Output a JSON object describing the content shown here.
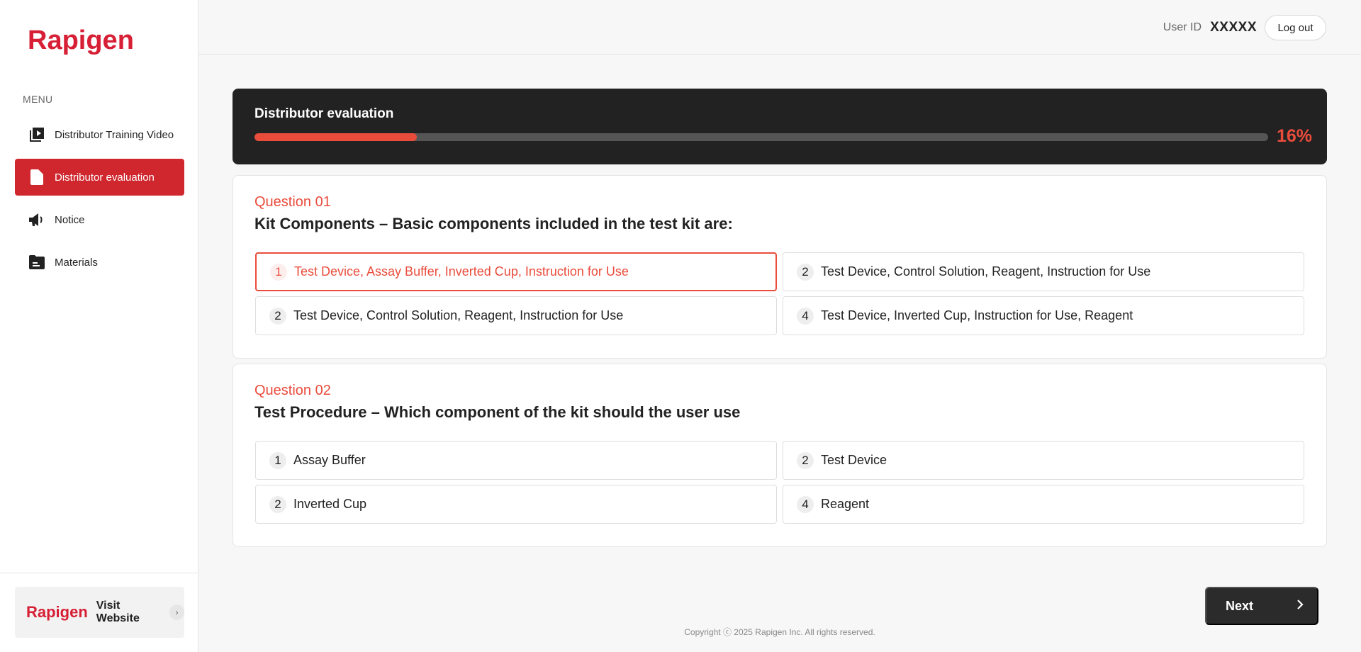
{
  "sidebar": {
    "logo": "Rapigen",
    "menu_label": "MENU",
    "items": [
      {
        "label": "Distributor Training Video",
        "icon": "video-playlist-icon"
      },
      {
        "label": "Distributor evaluation",
        "icon": "document-icon",
        "active": true
      },
      {
        "label": "Notice",
        "icon": "megaphone-icon"
      },
      {
        "label": "Materials",
        "icon": "folder-icon"
      }
    ],
    "visit": {
      "logo": "Rapigen",
      "label": "Visit Website"
    }
  },
  "header": {
    "user_label": "User ID",
    "user_id": "XXXXX",
    "logout_label": "Log out"
  },
  "progress": {
    "title": "Distributor evaluation",
    "percent": 16,
    "percent_label": "16%"
  },
  "questions": [
    {
      "number": "Question 01",
      "text": "Kit Components – Basic components included in the test kit are:",
      "options": [
        {
          "num": "1",
          "label": "Test Device, Assay Buffer, Inverted Cup, Instruction for Use",
          "selected": true
        },
        {
          "num": "2",
          "label": "Test Device, Control Solution, Reagent, Instruction for Use"
        },
        {
          "num": "2",
          "label": "Test Device, Control Solution, Reagent, Instruction for Use"
        },
        {
          "num": "4",
          "label": "Test Device, Inverted Cup, Instruction for Use, Reagent"
        }
      ]
    },
    {
      "number": "Question 02",
      "text": "Test Procedure – Which component of the kit should the user use",
      "options": [
        {
          "num": "1",
          "label": "Assay Buffer"
        },
        {
          "num": "2",
          "label": "Test Device"
        },
        {
          "num": "2",
          "label": "Inverted Cup"
        },
        {
          "num": "4",
          "label": "Reagent"
        }
      ]
    }
  ],
  "next_label": "Next",
  "copyright": "Copyright ⓒ 2025 Rapigen Inc. All rights reserved.",
  "colors": {
    "brand": "#d71f35",
    "accent": "#ea4c3c",
    "dark": "#222222"
  }
}
